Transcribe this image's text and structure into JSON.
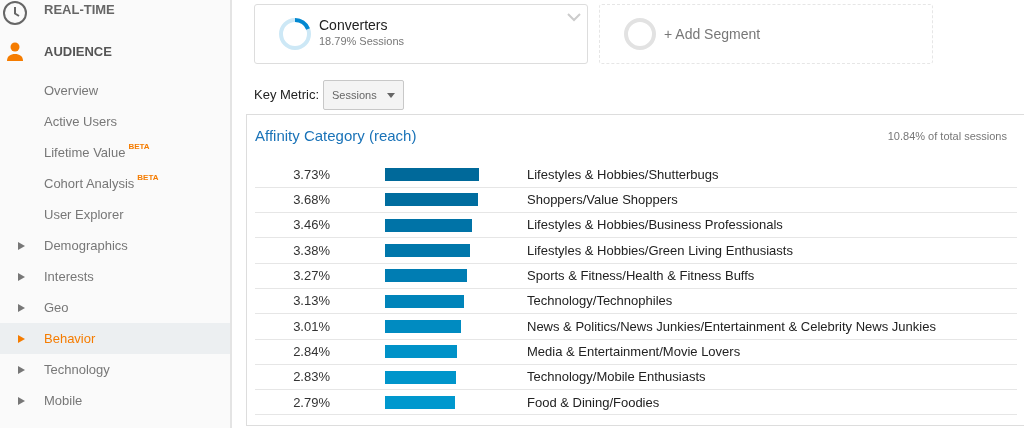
{
  "sidebar": {
    "items": [
      {
        "kind": "section",
        "label": "REAL-TIME",
        "selected": false
      },
      {
        "kind": "section",
        "label": "AUDIENCE",
        "selected": true
      },
      {
        "kind": "link",
        "label": "Overview",
        "selected": false
      },
      {
        "kind": "link",
        "label": "Active Users",
        "selected": false
      },
      {
        "kind": "link",
        "label": "Lifetime Value",
        "badge": "BETA",
        "selected": false
      },
      {
        "kind": "link",
        "label": "Cohort Analysis",
        "badge": "BETA",
        "selected": false
      },
      {
        "kind": "link",
        "label": "User Explorer",
        "selected": false
      },
      {
        "kind": "group",
        "label": "Demographics",
        "expanded": false,
        "selected": false
      },
      {
        "kind": "group",
        "label": "Interests",
        "expanded": false,
        "selected": false
      },
      {
        "kind": "group",
        "label": "Geo",
        "expanded": false,
        "selected": false
      },
      {
        "kind": "group",
        "label": "Behavior",
        "expanded": false,
        "selected": true
      },
      {
        "kind": "group",
        "label": "Technology",
        "expanded": false,
        "selected": false
      },
      {
        "kind": "group",
        "label": "Mobile",
        "expanded": false,
        "selected": false
      }
    ]
  },
  "segments": [
    {
      "kind": "segment",
      "name": "Converters",
      "detail": "18.79% Sessions",
      "level": 0.19
    },
    {
      "kind": "add",
      "name": "+ Add Segment"
    }
  ],
  "key_metric": {
    "label": "Key Metric:",
    "value": "Sessions"
  },
  "report": {
    "title": "Affinity Category (reach)",
    "summary": "10.84% of total sessions",
    "rows": [
      {
        "percent": "3.73%",
        "color": "#00699a",
        "category": "Lifestyles & Hobbies/Shutterbugs"
      },
      {
        "percent": "3.68%",
        "color": "#006d9f",
        "category": "Shoppers/Value Shoppers"
      },
      {
        "percent": "3.46%",
        "color": "#0073a7",
        "category": "Lifestyles & Hobbies/Business Professionals"
      },
      {
        "percent": "3.38%",
        "color": "#0077ab",
        "category": "Lifestyles & Hobbies/Green Living Enthusiasts"
      },
      {
        "percent": "3.27%",
        "color": "#007db3",
        "category": "Sports & Fitness/Health & Fitness Buffs"
      },
      {
        "percent": "3.13%",
        "color": "#0084ba",
        "category": "Technology/Technophiles"
      },
      {
        "percent": "3.01%",
        "color": "#008bc1",
        "category": "News & Politics/News Junkies/Entertainment & Celebrity News Junkies"
      },
      {
        "percent": "2.84%",
        "color": "#0092c8",
        "category": "Media & Entertainment/Movie Lovers"
      },
      {
        "percent": "2.83%",
        "color": "#0095cb",
        "category": "Technology/Mobile Enthusiasts"
      },
      {
        "percent": "2.79%",
        "color": "#0098ce",
        "category": "Food & Dining/Foodies"
      }
    ]
  }
}
